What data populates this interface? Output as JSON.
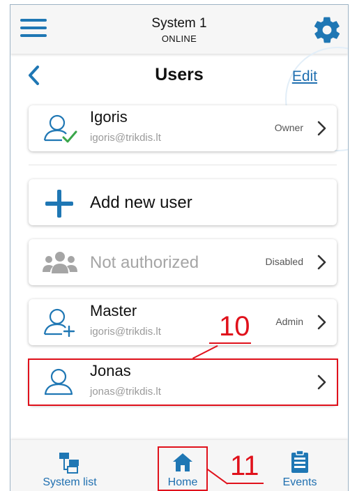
{
  "header": {
    "system_name": "System 1",
    "status": "ONLINE",
    "menu_icon": "hamburger-menu-icon",
    "settings_icon": "gear-icon"
  },
  "page": {
    "title": "Users",
    "edit_label": "Edit",
    "back_icon": "chevron-left-icon"
  },
  "owner_user": {
    "name": "Igoris",
    "email": "igoris@trikdis.lt",
    "role": "Owner",
    "icon": "user-check-icon"
  },
  "add_user": {
    "label": "Add new user",
    "icon": "plus-icon"
  },
  "users": [
    {
      "kind": "group",
      "name": "Not authorized",
      "email": "",
      "role": "Disabled",
      "icon": "user-group-icon"
    },
    {
      "kind": "user",
      "name": "Master",
      "email": "igoris@trikdis.lt",
      "role": "Admin",
      "icon": "user-plus-icon"
    },
    {
      "kind": "user",
      "name": "Jonas",
      "email": "jonas@trikdis.lt",
      "role": "",
      "icon": "user-outline-icon"
    }
  ],
  "annotations": {
    "callout_user": "10",
    "callout_home": "11"
  },
  "bottom_nav": {
    "items": [
      {
        "label": "System list",
        "icon": "system-list-icon"
      },
      {
        "label": "Home",
        "icon": "home-icon"
      },
      {
        "label": "Events",
        "icon": "events-clipboard-icon"
      }
    ]
  },
  "colors": {
    "accent": "#1f77b4",
    "link": "#1f6fb0",
    "annotation": "#e0111b",
    "muted_text": "#9a9a9a"
  }
}
